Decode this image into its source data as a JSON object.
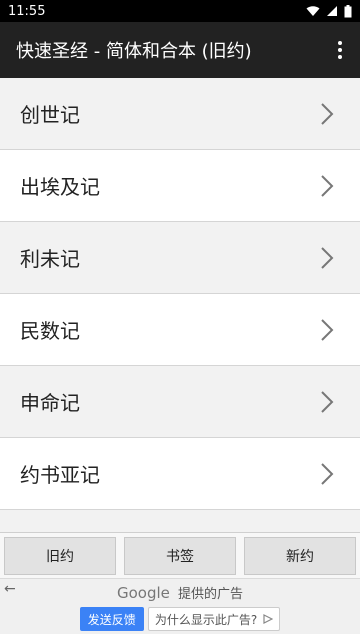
{
  "status_bar": {
    "time": "11:55"
  },
  "app_bar": {
    "title": "快速圣经 - 简体和合本 (旧约)"
  },
  "books": [
    {
      "label": "创世记"
    },
    {
      "label": "出埃及记"
    },
    {
      "label": "利未记"
    },
    {
      "label": "民数记"
    },
    {
      "label": "申命记"
    },
    {
      "label": "约书亚记"
    }
  ],
  "tabs": {
    "old_testament": "旧约",
    "bookmarks": "书签",
    "new_testament": "新约"
  },
  "ad": {
    "brand": "Google",
    "provided_text": "提供的广告",
    "feedback_label": "发送反馈",
    "why_label": "为什么显示此广告?"
  },
  "colors": {
    "app_bar": "#222222",
    "feedback_button": "#3b82f6"
  },
  "icons": {
    "status": [
      "wifi-icon",
      "signal-icon",
      "battery-icon"
    ],
    "menu": "more-vert-icon",
    "row": "chevron-right-icon",
    "ad_back": "back-arrow-icon",
    "ad_why": "ad-choices-icon"
  }
}
